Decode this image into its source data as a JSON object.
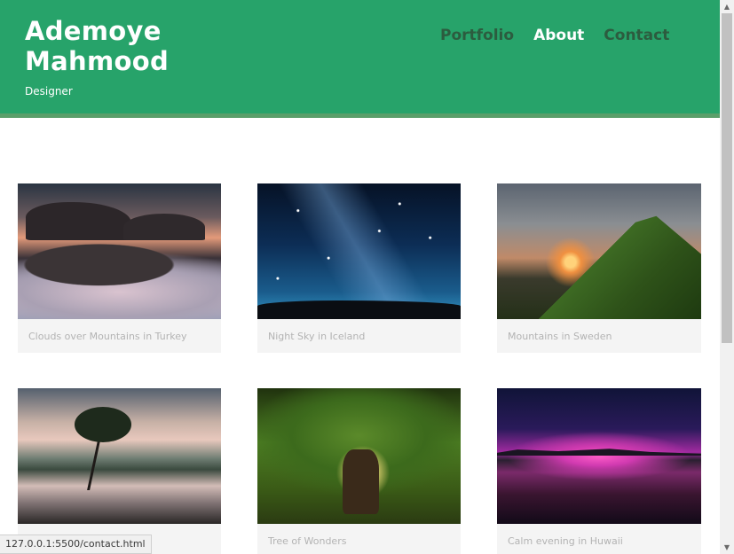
{
  "header": {
    "name": "Ademoye Mahmood",
    "tagline": "Designer"
  },
  "nav": [
    {
      "label": "Portfolio",
      "active": false
    },
    {
      "label": "About",
      "active": true
    },
    {
      "label": "Contact",
      "active": false
    }
  ],
  "gallery": [
    {
      "caption": "Clouds over Mountains in Turkey",
      "image": "mountains-clouds"
    },
    {
      "caption": "Night Sky in Iceland",
      "image": "milky-way"
    },
    {
      "caption": "Mountains in Sweden",
      "image": "mountain-sunset"
    },
    {
      "caption": "",
      "image": "lake-tree"
    },
    {
      "caption": "Tree of Wonders",
      "image": "big-tree"
    },
    {
      "caption": "Calm evening in Huwaii",
      "image": "pink-sunset-lake"
    }
  ],
  "status_bar": {
    "url": "127.0.0.1:5500/contact.html"
  },
  "colors": {
    "header_bg": "#27a36a",
    "header_border": "#5a9f6a",
    "nav_inactive": "#2c5c3f",
    "nav_active": "#ffffff",
    "caption_text": "#b3b3b3",
    "card_bg": "#f4f4f4"
  },
  "icons": {
    "scroll_up": "triangle-up-icon",
    "scroll_down": "triangle-down-icon"
  }
}
